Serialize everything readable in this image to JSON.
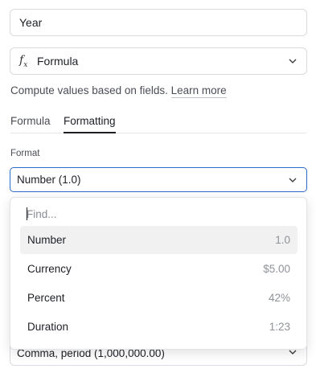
{
  "name_field": {
    "value": "Year"
  },
  "type_select": {
    "icon": "function-icon",
    "label": "Formula"
  },
  "help": {
    "text": "Compute values based on fields.",
    "link": "Learn more"
  },
  "tabs": [
    {
      "label": "Formula",
      "active": false
    },
    {
      "label": "Formatting",
      "active": true
    }
  ],
  "format": {
    "label": "Format",
    "selected": "Number (1.0)",
    "accent_color": "#2d6bc9"
  },
  "dropdown": {
    "find_placeholder": "Find...",
    "options": [
      {
        "label": "Number",
        "example": "1.0"
      },
      {
        "label": "Currency",
        "example": "$5.00"
      },
      {
        "label": "Percent",
        "example": "42%"
      },
      {
        "label": "Duration",
        "example": "1:23"
      }
    ]
  },
  "separator_select": {
    "value": "Comma, period (1,000,000.00)"
  }
}
